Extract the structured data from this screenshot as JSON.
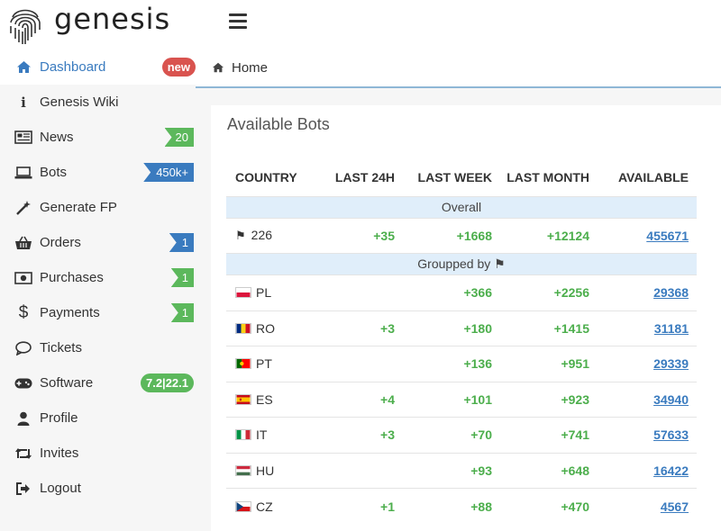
{
  "brand": {
    "name": "genesis"
  },
  "sidebar": {
    "items": [
      {
        "label": "Dashboard",
        "icon": "home-icon",
        "badge": "new"
      },
      {
        "label": "Genesis Wiki",
        "icon": "info-icon",
        "badge": null
      },
      {
        "label": "News",
        "icon": "newspaper-icon",
        "badge": "20"
      },
      {
        "label": "Bots",
        "icon": "laptop-icon",
        "badge": "450k+"
      },
      {
        "label": "Generate FP",
        "icon": "magic-wand-icon",
        "badge": null
      },
      {
        "label": "Orders",
        "icon": "basket-icon",
        "badge": "1"
      },
      {
        "label": "Purchases",
        "icon": "money-icon",
        "badge": "1"
      },
      {
        "label": "Payments",
        "icon": "dollar-icon",
        "badge": "1"
      },
      {
        "label": "Tickets",
        "icon": "chat-icon",
        "badge": null
      },
      {
        "label": "Software",
        "icon": "gamepad-icon",
        "badge": "7.2|22.1"
      },
      {
        "label": "Profile",
        "icon": "user-icon",
        "badge": null
      },
      {
        "label": "Invites",
        "icon": "retweet-icon",
        "badge": null
      },
      {
        "label": "Logout",
        "icon": "sign-out-icon",
        "badge": null
      }
    ]
  },
  "breadcrumb": {
    "home": "Home"
  },
  "panel": {
    "title": "Available Bots",
    "columns": [
      "COUNTRY",
      "LAST 24H",
      "LAST WEEK",
      "LAST MONTH",
      "AVAILABLE"
    ],
    "overall_label": "Overall",
    "overall": {
      "country": "226",
      "last24h": "+35",
      "lastweek": "+1668",
      "lastmonth": "+12124",
      "available": "455671"
    },
    "grouped_label": "Groupped by",
    "rows": [
      {
        "code": "PL",
        "last24h": "",
        "lastweek": "+366",
        "lastmonth": "+2256",
        "available": "29368"
      },
      {
        "code": "RO",
        "last24h": "+3",
        "lastweek": "+180",
        "lastmonth": "+1415",
        "available": "31181"
      },
      {
        "code": "PT",
        "last24h": "",
        "lastweek": "+136",
        "lastmonth": "+951",
        "available": "29339"
      },
      {
        "code": "ES",
        "last24h": "+4",
        "lastweek": "+101",
        "lastmonth": "+923",
        "available": "34940"
      },
      {
        "code": "IT",
        "last24h": "+3",
        "lastweek": "+70",
        "lastmonth": "+741",
        "available": "57633"
      },
      {
        "code": "HU",
        "last24h": "",
        "lastweek": "+93",
        "lastmonth": "+648",
        "available": "16422"
      },
      {
        "code": "CZ",
        "last24h": "+1",
        "lastweek": "+88",
        "lastmonth": "+470",
        "available": "4567"
      }
    ]
  },
  "colors": {
    "accent": "#3a7bbf",
    "positive": "#4cae4c",
    "badge_red": "#d9534f",
    "badge_green": "#5cb85c"
  }
}
